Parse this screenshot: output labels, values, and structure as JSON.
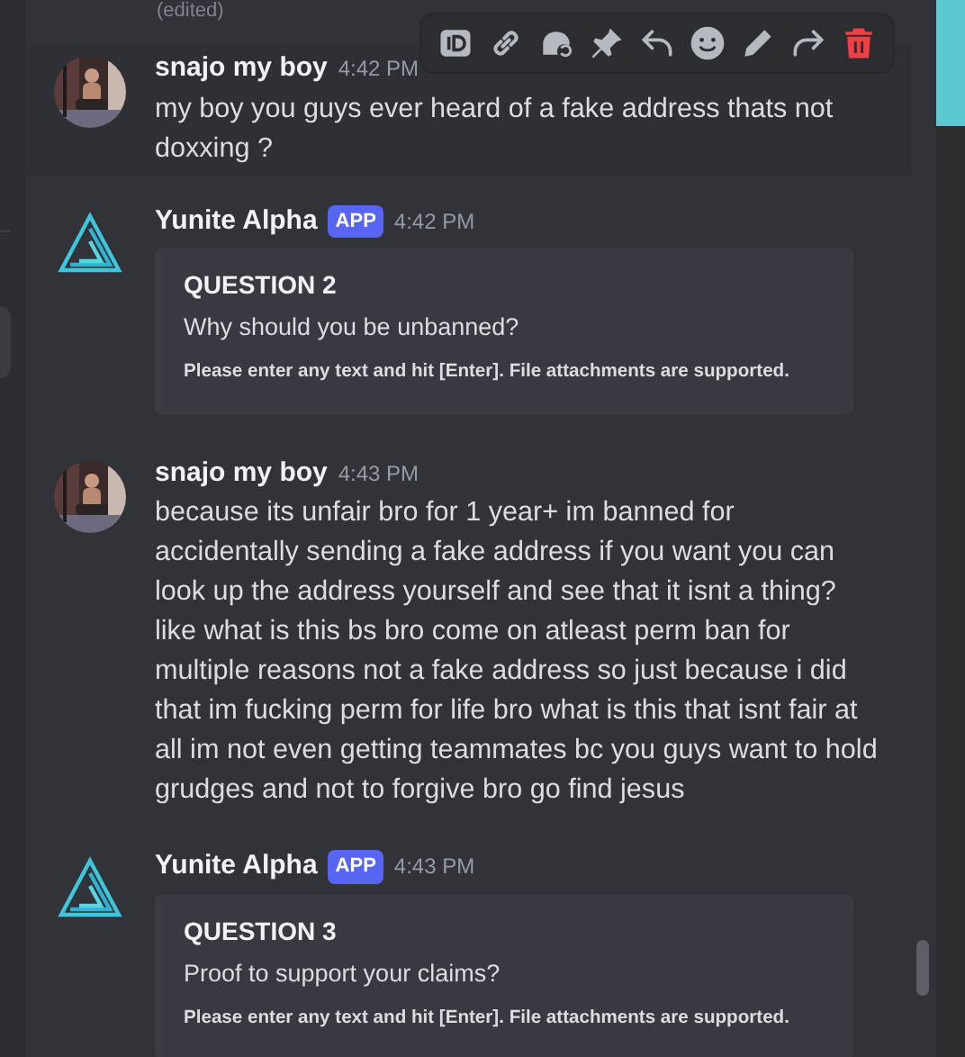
{
  "edited_note": "(edited)",
  "messages": [
    {
      "kind": "user",
      "author": "snajo my boy",
      "time": "4:42 PM",
      "hovered": true,
      "text": "my boy you guys ever heard of a fake address thats not doxxing ?"
    },
    {
      "kind": "bot",
      "author": "Yunite Alpha",
      "tag": "APP",
      "time": "4:42 PM",
      "hovered": false,
      "embed": {
        "title": "QUESTION 2",
        "description": "Why should you be unbanned?",
        "footer": "Please enter any text and hit [Enter]. File attachments are supported."
      }
    },
    {
      "kind": "user",
      "author": "snajo my boy",
      "time": "4:43 PM",
      "hovered": false,
      "text": "because its unfair bro for 1 year+ im banned for accidentally sending a fake address if you want you can look up the address yourself and see that it isnt a thing? like what is this bs bro come on atleast perm ban for multiple reasons not a fake address so just because i did that im fucking perm for life bro what is this that isnt fair at all im not even getting teammates bc you guys want to hold grudges and not to forgive bro go find jesus"
    },
    {
      "kind": "bot",
      "author": "Yunite Alpha",
      "tag": "APP",
      "time": "4:43 PM",
      "hovered": false,
      "embed": {
        "title": "QUESTION 3",
        "description": "Proof to support your claims?",
        "footer": "Please enter any text and hit [Enter]. File attachments are supported."
      }
    }
  ]
}
